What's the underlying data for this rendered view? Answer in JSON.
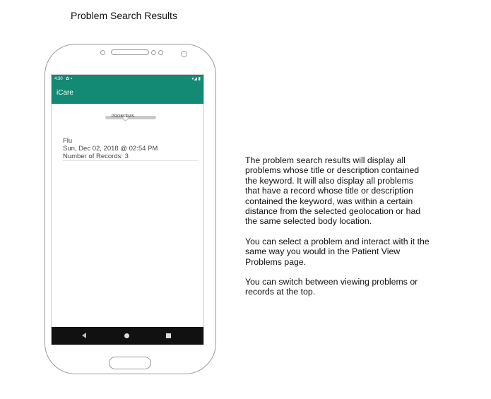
{
  "page": {
    "title": "Problem Search Results"
  },
  "status_bar": {
    "time": "4:30",
    "left_icons": "✿ ▪",
    "right_icons": "▾◢ ▮"
  },
  "app_bar": {
    "title": "iCare"
  },
  "toggle": {
    "label": "PROBLEMS"
  },
  "results": [
    {
      "title": "Flu",
      "date": "Sun, Dec 02, 2018 @ 02:54 PM",
      "records": "Number of Records: 3"
    }
  ],
  "nav_bar": {
    "back": "back-icon",
    "home": "home-icon",
    "recent": "recent-apps-icon"
  },
  "description": {
    "p1": "The problem search results will display all\nproblems whose title or description contained\nthe keyword. It will also display all problems\nthat have a record whose title or description\ncontained the keyword, was within a certain\ndistance from the selected geolocation or had\nthe same selected body location.",
    "p2": "You can select a problem and interact with it the\nsame way you would in the Patient View\nProblems page.",
    "p3": "You can switch between viewing problems or\nrecords at the top."
  },
  "colors": {
    "app_bar": "#138a73",
    "nav_bar": "#111111"
  }
}
